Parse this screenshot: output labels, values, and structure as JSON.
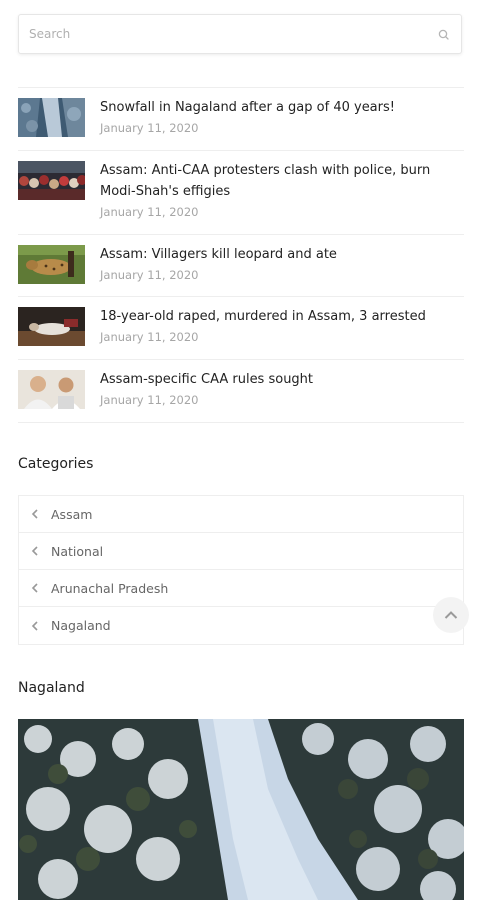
{
  "search": {
    "placeholder": "Search",
    "icon": "search-icon"
  },
  "posts": [
    {
      "title": "Snowfall in Nagaland after a gap of 40 years!",
      "date": "January 11, 2020",
      "thumb": "snow-path"
    },
    {
      "title": "Assam: Anti-CAA protesters clash with police, burn Modi-Shah's effigies",
      "date": "January 11, 2020",
      "thumb": "crowd"
    },
    {
      "title": "Assam: Villagers kill leopard and ate",
      "date": "January 11, 2020",
      "thumb": "leopard"
    },
    {
      "title": "18-year-old raped, murdered in Assam, 3 arrested",
      "date": "January 11, 2020",
      "thumb": "body"
    },
    {
      "title": "Assam-specific CAA rules sought",
      "date": "January 11, 2020",
      "thumb": "two-men"
    }
  ],
  "categories": {
    "title": "Categories",
    "items": [
      "Assam",
      "National",
      "Arunachal Pradesh",
      "Nagaland"
    ]
  },
  "nagaland": {
    "title": "Nagaland"
  },
  "colors": {
    "border": "#eeeeee",
    "date": "#a6a6a6",
    "link": "#666666"
  }
}
